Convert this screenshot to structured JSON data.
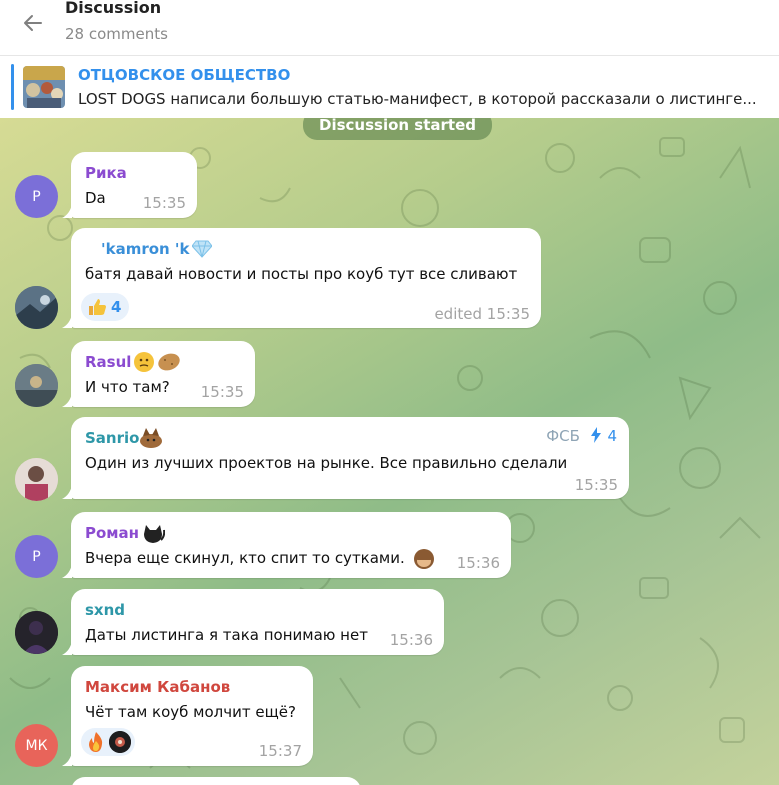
{
  "header": {
    "title": "Discussion",
    "subtitle": "28 comments"
  },
  "pinned": {
    "channel": "ОТЦОВСКОЕ ОБЩЕСТВО",
    "text": "LOST DOGS написали большую статью-манифест, в которой рассказали о листинге..."
  },
  "service": {
    "label": "Discussion started"
  },
  "messages": [
    {
      "author": "Рика",
      "author_color": "#8b4bd0",
      "avatar_initial": "Р",
      "avatar_color": "#7b6fd8",
      "text": "Da",
      "time": "15:35"
    },
    {
      "author": "'kamron 'k",
      "author_color": "#3a8fd8",
      "text": "батя давай новости и посты про коуб тут все сливают",
      "time": "edited 15:35",
      "reaction_icon": "thumbs-up",
      "reaction_count": "4"
    },
    {
      "author": "Rasul",
      "author_color": "#8b4bd0",
      "text": "И что там?",
      "time": "15:35"
    },
    {
      "author": "Sanrio",
      "author_color": "#2e97a8",
      "badge": "ФСБ",
      "boost": "4",
      "text": "Один из лучших проектов на рынке. Все правильно сделали",
      "time": "15:35"
    },
    {
      "author": "Роман",
      "author_color": "#8b4bd0",
      "avatar_initial": "Р",
      "avatar_color": "#7b6fd8",
      "text": "Вчера еще скинул, кто спит то сутками.",
      "time": "15:36"
    },
    {
      "author": "sxnd",
      "author_color": "#2e97a8",
      "text": "Даты листинга я така понимаю нет",
      "time": "15:36"
    },
    {
      "author": "Максим Кабанов",
      "author_color": "#d0473e",
      "avatar_initial": "МК",
      "avatar_color": "#e8645a",
      "text": "Чёт там коуб молчит ещё?",
      "time": "15:37",
      "reaction_icon": "fire"
    }
  ],
  "colors": {
    "accent": "#3390ec"
  }
}
